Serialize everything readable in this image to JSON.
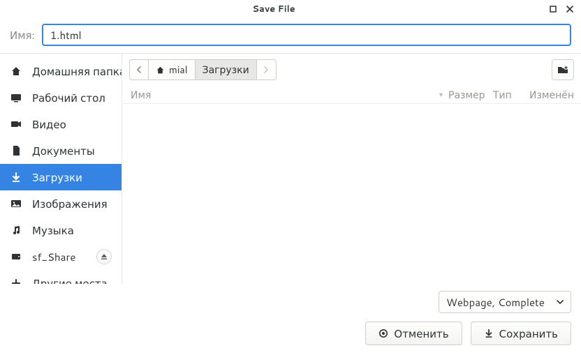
{
  "window": {
    "title": "Save File"
  },
  "name_field": {
    "label": "Имя:",
    "value": "1.html"
  },
  "sidebar": {
    "items": [
      {
        "icon": "home",
        "label": "Домашняя папка"
      },
      {
        "icon": "desktop",
        "label": "Рабочий стол"
      },
      {
        "icon": "video",
        "label": "Видео"
      },
      {
        "icon": "document",
        "label": "Документы"
      },
      {
        "icon": "download",
        "label": "Загрузки",
        "selected": true
      },
      {
        "icon": "image",
        "label": "Изображения"
      },
      {
        "icon": "music",
        "label": "Музыка"
      },
      {
        "icon": "drive",
        "label": "sf_Share",
        "ejectable": true
      },
      {
        "icon": "plus",
        "label": "Другие места"
      }
    ]
  },
  "path": {
    "segments": [
      {
        "label": "mial",
        "icon": "home"
      },
      {
        "label": "Загрузки",
        "active": true
      }
    ]
  },
  "table": {
    "columns": {
      "name": "Имя",
      "size": "Размер",
      "type": "Тип",
      "modified": "Изменён"
    }
  },
  "format": {
    "selected": "Webpage, Complete"
  },
  "actions": {
    "cancel": "Отменить",
    "save": "Сохранить"
  }
}
